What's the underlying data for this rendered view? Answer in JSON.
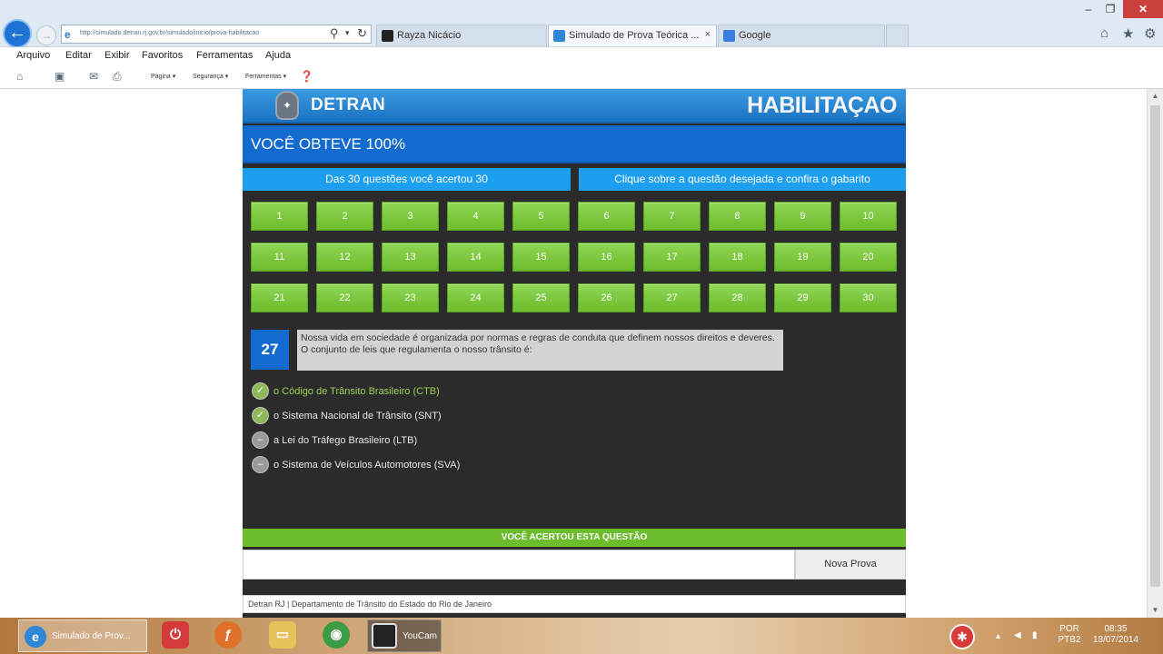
{
  "browser": {
    "address_url": "http://simulado.detran.rj.gov.br/simulado/inicio/prova-habilitacao",
    "tabs": [
      {
        "label": "Rayza Nicácio"
      },
      {
        "label": "Simulado de Prova Teórica ..."
      },
      {
        "label": "Google"
      }
    ],
    "tab_close": "×",
    "window_controls": {
      "minimize": "‒",
      "maximize": "❐",
      "close": "✕"
    },
    "menu": [
      "Arquivo",
      "Editar",
      "Exibir",
      "Favoritos",
      "Ferramentas",
      "Ajuda"
    ],
    "commands": [
      "Página ▾",
      "Segurança ▾",
      "Ferramentas ▾"
    ]
  },
  "app": {
    "brand": "DETRAN",
    "section_title": "HABILITAÇAO",
    "score_text": "VOCÊ OBTEVE 100%",
    "summary_text": "Das 30 questões você acertou 30",
    "instruction_text": "Clique sobre a questão desejada e confira o gabarito",
    "questions": [
      "1",
      "2",
      "3",
      "4",
      "5",
      "6",
      "7",
      "8",
      "9",
      "10",
      "11",
      "12",
      "13",
      "14",
      "15",
      "16",
      "17",
      "18",
      "19",
      "20",
      "21",
      "22",
      "23",
      "24",
      "25",
      "26",
      "27",
      "28",
      "29",
      "30"
    ],
    "current_question": {
      "number": "27",
      "text": "Nossa vida em sociedade é organizada por normas e regras de conduta que definem nossos direitos e deveres. O conjunto de leis que regulamenta o nosso trânsito é:",
      "answers": [
        {
          "label": "o Código de Trânsito Brasileiro (CTB)",
          "correct": true
        },
        {
          "label": "o Sistema Nacional de Trânsito (SNT)",
          "correct": false
        },
        {
          "label": "a Lei do Tráfego Brasileiro (LTB)",
          "correct": false
        },
        {
          "label": "o Sistema de Veículos Automotores (SVA)",
          "correct": false
        }
      ]
    },
    "result_text": "VOCÊ ACERTOU ESTA QUESTÃO",
    "new_test_label": "Nova Prova",
    "footer_text": "Detran RJ | Departamento de Trânsito do Estado do Rio de Janeiro"
  },
  "taskbar": {
    "ie_task_label": "Simulado de Prov...",
    "youcam_label": "YouCam",
    "lang_line1": "POR",
    "lang_line2": "PTB2",
    "time": "08:35",
    "date": "18/07/2014"
  },
  "colors": {
    "header_blue": "#1b73c2",
    "score_blue": "#136bd0",
    "info_blue": "#1c9ff0",
    "button_green": "#6cbc2c",
    "panel_dark": "#2b2b2b"
  }
}
